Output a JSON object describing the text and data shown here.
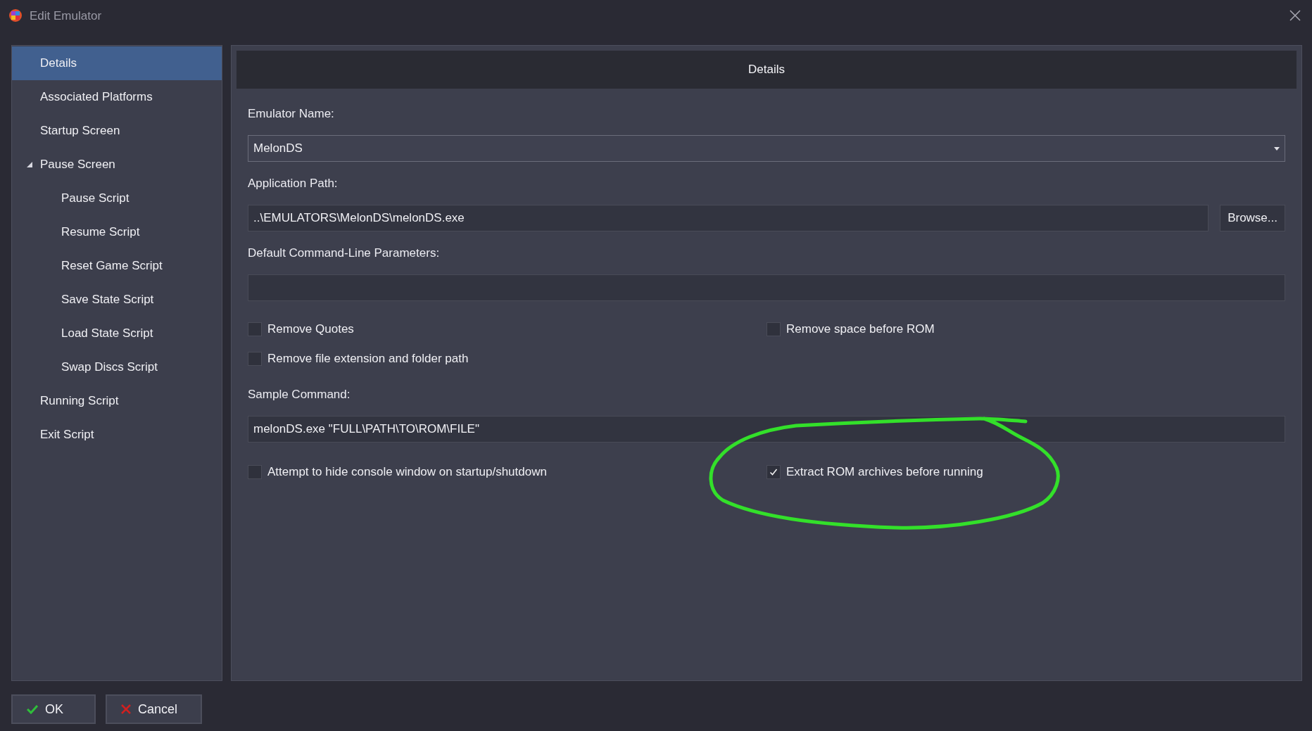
{
  "window": {
    "title": "Edit Emulator"
  },
  "sidebar": {
    "items": [
      {
        "label": "Details",
        "selected": true
      },
      {
        "label": "Associated Platforms",
        "selected": false
      },
      {
        "label": "Startup Screen",
        "selected": false
      },
      {
        "label": "Pause Screen",
        "selected": false,
        "expanded": true,
        "children": [
          {
            "label": "Pause Script",
            "selected": false
          },
          {
            "label": "Resume Script",
            "selected": false
          },
          {
            "label": "Reset Game Script",
            "selected": false
          },
          {
            "label": "Save State Script",
            "selected": false
          },
          {
            "label": "Load State Script",
            "selected": false
          },
          {
            "label": "Swap Discs Script",
            "selected": false
          }
        ]
      },
      {
        "label": "Running Script",
        "selected": false
      },
      {
        "label": "Exit Script",
        "selected": false
      }
    ]
  },
  "panel": {
    "title": "Details",
    "emulator_name": {
      "label": "Emulator Name:",
      "value": "MelonDS"
    },
    "application_path": {
      "label": "Application Path:",
      "value": "..\\EMULATORS\\MelonDS\\melonDS.exe",
      "button": "Browse..."
    },
    "parameters": {
      "label": "Default Command-Line Parameters:"
    },
    "options": [
      {
        "label": "Remove Quotes",
        "checked": false
      },
      {
        "label": "Remove space before ROM",
        "checked": false
      },
      {
        "label": "Remove file extension and folder path",
        "checked": false
      }
    ],
    "sample_command": {
      "label": "Sample Command:",
      "value": "melonDS.exe \"FULL\\PATH\\TO\\ROM\\FILE\""
    },
    "startup_options": [
      {
        "label": "Attempt to hide console window on startup/shutdown",
        "checked": false
      },
      {
        "label": "Extract ROM archives before running",
        "checked": true
      }
    ]
  },
  "buttons": [
    {
      "label": "OK",
      "kind": "ok"
    },
    {
      "label": "Cancel",
      "kind": "cancel"
    }
  ]
}
